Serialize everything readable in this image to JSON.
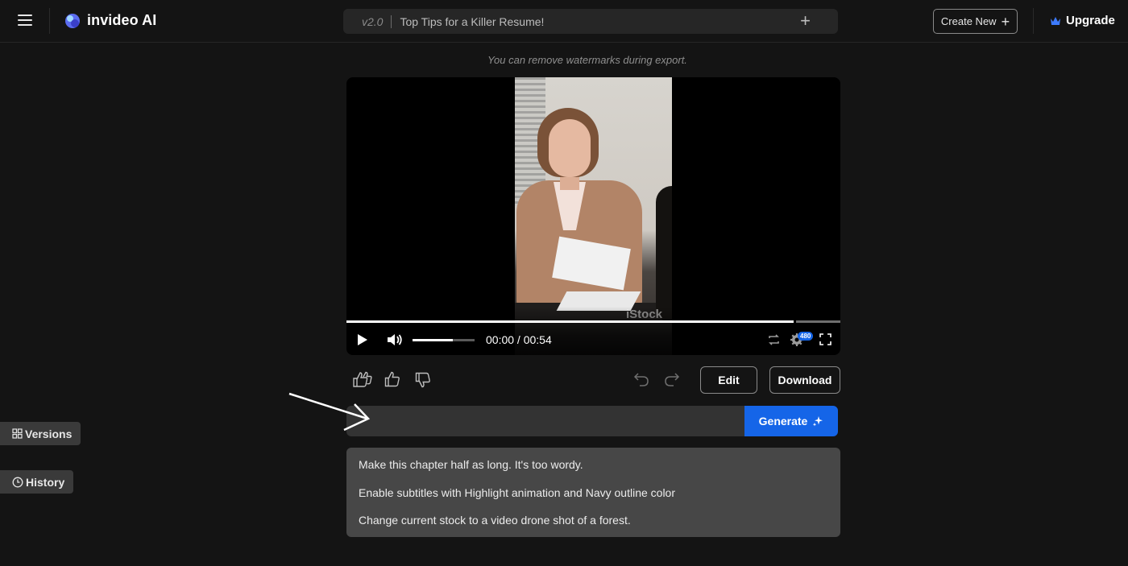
{
  "header": {
    "app_name": "invideo AI",
    "version": "v2.0",
    "video_title": "Top Tips for a Killer Resume!",
    "create_new_label": "Create New",
    "upgrade_label": "Upgrade"
  },
  "notice": "You can remove watermarks during export.",
  "player": {
    "watermark_text": "iStock",
    "current_time": "00:00",
    "duration": "00:54",
    "time_display": "00:00 / 00:54",
    "progress": 0.905,
    "volume": 0.65,
    "quality_badge": "480"
  },
  "actions": {
    "edit_label": "Edit",
    "download_label": "Download"
  },
  "prompt": {
    "value": "",
    "placeholder": "",
    "generate_label": "Generate"
  },
  "suggestions": [
    "Make this chapter half as long. It's too wordy.",
    "Enable subtitles with Highlight animation and Navy outline color",
    "Change current stock to a video drone shot of a forest."
  ],
  "sidebar": {
    "versions_label": "Versions",
    "history_label": "History"
  },
  "colors": {
    "background": "#141414",
    "accent": "#1565e8",
    "panel": "#474747",
    "input": "#333333"
  }
}
